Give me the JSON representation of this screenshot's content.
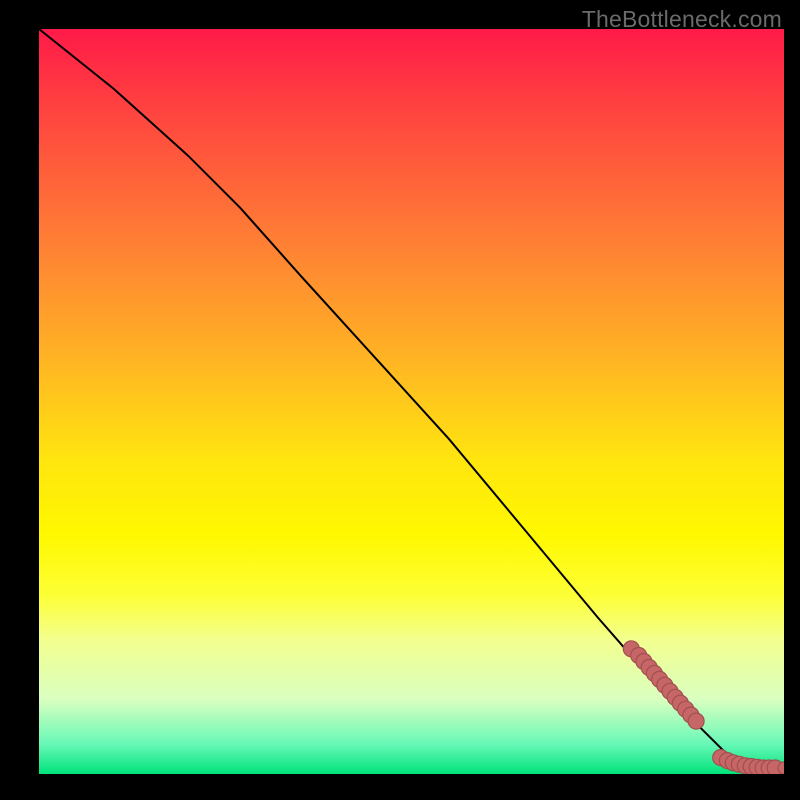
{
  "watermark": "TheBottleneck.com",
  "chart_data": {
    "type": "line",
    "title": "",
    "xlabel": "",
    "ylabel": "",
    "xlim": [
      0,
      100
    ],
    "ylim": [
      0,
      100
    ],
    "grid": false,
    "legend": false,
    "series": [
      {
        "name": "curve",
        "type": "line",
        "x": [
          0,
          10,
          20,
          27,
          35,
          45,
          55,
          65,
          75,
          82,
          88,
          92,
          96,
          100
        ],
        "y": [
          100,
          92,
          83,
          76,
          67,
          56,
          45,
          33,
          21,
          13,
          7,
          3,
          1,
          0.5
        ]
      },
      {
        "name": "cluster-upper",
        "type": "scatter",
        "x": [
          79.5,
          80.5,
          81.2,
          81.9,
          82.6,
          83.3,
          84.0,
          84.7,
          85.4,
          86.1,
          86.8,
          87.5,
          88.2
        ],
        "y": [
          16.8,
          15.9,
          15.1,
          14.3,
          13.5,
          12.7,
          11.9,
          11.1,
          10.3,
          9.5,
          8.7,
          7.9,
          7.1
        ]
      },
      {
        "name": "cluster-lower",
        "type": "scatter",
        "x": [
          91.5,
          92.4,
          93.2,
          94.0,
          94.8,
          95.6,
          96.4,
          97.2,
          98.0,
          98.8
        ],
        "y": [
          2.2,
          1.8,
          1.5,
          1.3,
          1.1,
          1.0,
          0.9,
          0.8,
          0.8,
          0.8
        ]
      },
      {
        "name": "outlier",
        "type": "scatter",
        "x": [
          100.0
        ],
        "y": [
          0.8
        ]
      }
    ]
  },
  "colors": {
    "curve": "#000000",
    "marker_fill": "#c76666",
    "marker_stroke": "#a14f4f",
    "background_top": "#ff1a49",
    "background_bottom": "#00e37a"
  }
}
